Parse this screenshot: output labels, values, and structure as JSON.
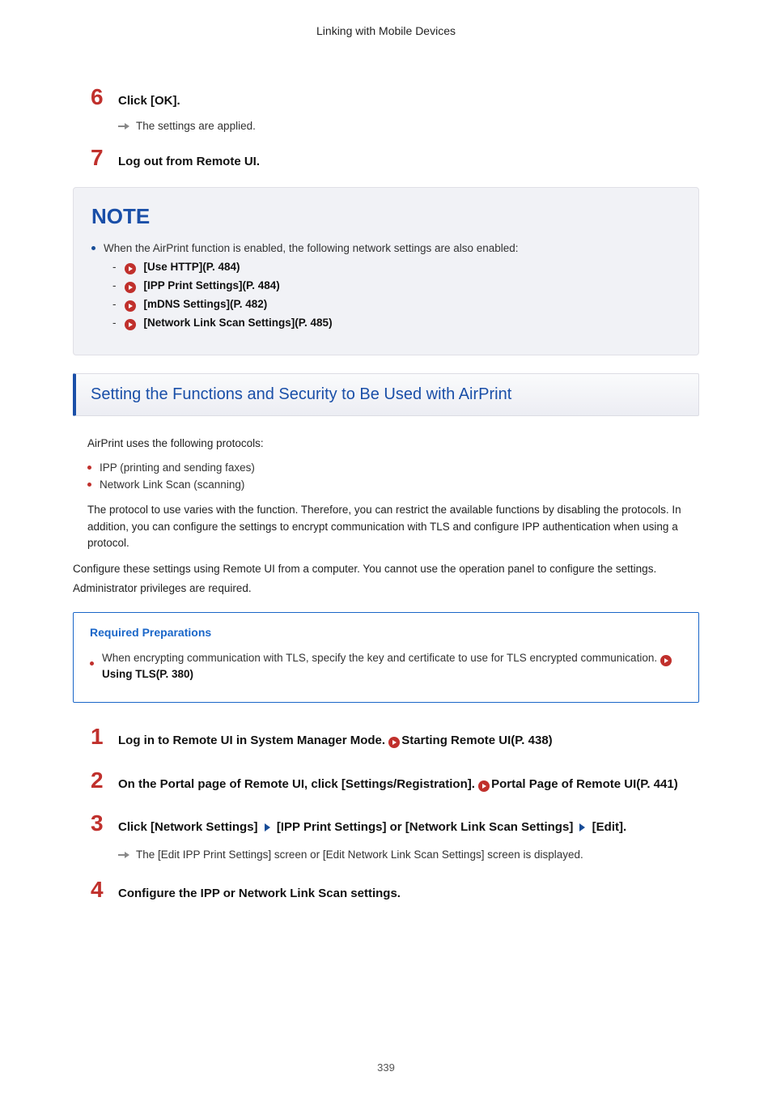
{
  "header": "Linking with Mobile Devices",
  "steps_a": {
    "six": {
      "num": "6",
      "title": "Click [OK].",
      "sub": "The settings are applied."
    },
    "seven": {
      "num": "7",
      "title": "Log out from Remote UI."
    }
  },
  "note": {
    "label": "NOTE",
    "lead": "When the AirPrint function is enabled, the following network settings are also enabled:",
    "items": [
      "[Use HTTP](P. 484)",
      "[IPP Print Settings](P. 484)",
      "[mDNS Settings](P. 482)",
      "[Network Link Scan Settings](P. 485)"
    ]
  },
  "section": {
    "title": "Setting the Functions and Security to Be Used with AirPrint",
    "intro": "AirPrint uses the following protocols:",
    "protocols": [
      "IPP (printing and sending faxes)",
      "Network Link Scan (scanning)"
    ],
    "para1": "The protocol to use varies with the function. Therefore, you can restrict the available functions by disabling the protocols. In addition, you can configure the settings to encrypt communication with TLS and configure IPP authentication when using a protocol.",
    "para2": "Configure these settings using Remote UI from a computer. You cannot use the operation panel to configure the settings.",
    "para3": "Administrator privileges are required."
  },
  "prep": {
    "title": "Required Preparations",
    "body_a": "When encrypting communication with TLS, specify the key and certificate to use for TLS encrypted communication. ",
    "link": "Using TLS(P. 380)"
  },
  "steps_b": {
    "one": {
      "num": "1",
      "title_a": "Log in to Remote UI in System Manager Mode. ",
      "link": "Starting Remote UI(P. 438)"
    },
    "two": {
      "num": "2",
      "title_a": "On the Portal page of Remote UI, click [Settings/Registration]. ",
      "link": "Portal Page of Remote UI(P. 441)"
    },
    "three": {
      "num": "3",
      "a": "Click [Network Settings] ",
      "b": " [IPP Print Settings] or [Network Link Scan Settings] ",
      "c": " [Edit].",
      "sub": "The [Edit IPP Print Settings] screen or [Edit Network Link Scan Settings] screen is displayed."
    },
    "four": {
      "num": "4",
      "title": "Configure the IPP or Network Link Scan settings."
    }
  },
  "pagenum": "339"
}
